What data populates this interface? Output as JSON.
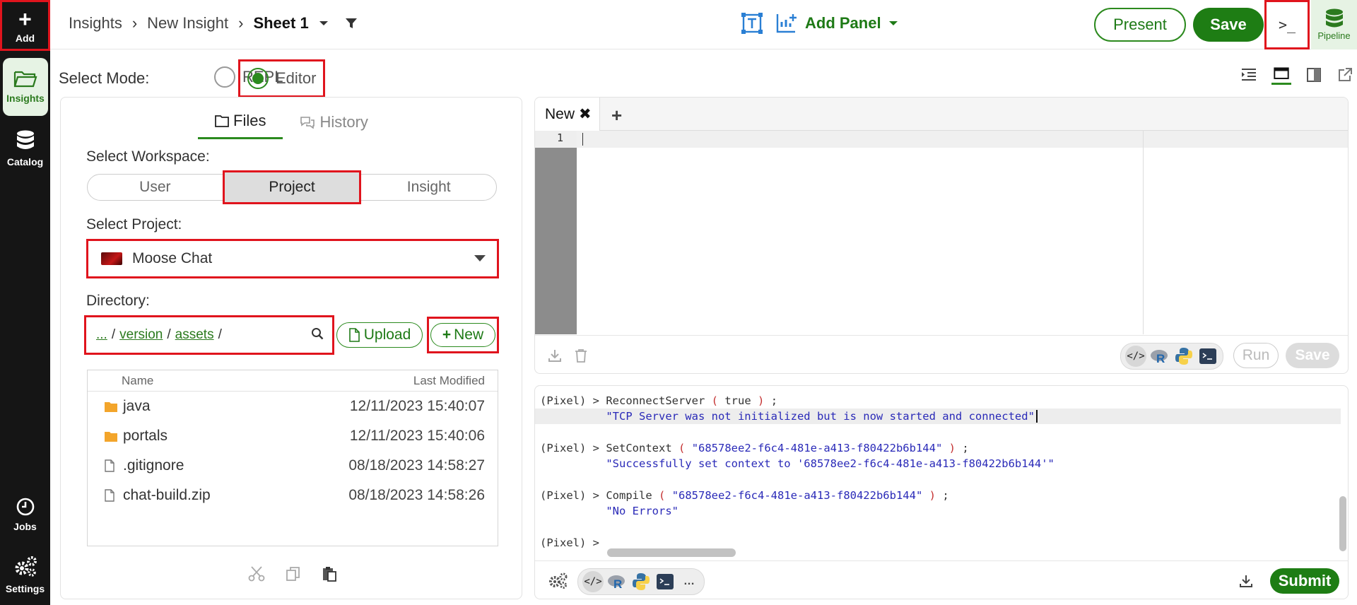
{
  "rail": {
    "add_label": "Add",
    "insights_label": "Insights",
    "catalog_label": "Catalog",
    "jobs_label": "Jobs",
    "settings_label": "Settings"
  },
  "header": {
    "crumbs": [
      "Insights",
      "New Insight"
    ],
    "sheet": "Sheet 1",
    "add_panel_label": "Add Panel",
    "present_label": "Present",
    "save_label": "Save",
    "terminal_glyph": ">_",
    "pipeline_label": "Pipeline"
  },
  "mode": {
    "label": "Select Mode:",
    "options": [
      "REPL",
      "Editor"
    ],
    "selected": "Editor"
  },
  "files_panel": {
    "tabs": [
      "Files",
      "History"
    ],
    "active_tab": "Files",
    "workspace_label": "Select Workspace:",
    "workspaces": [
      "User",
      "Project",
      "Insight"
    ],
    "selected_workspace": "Project",
    "project_label": "Select Project:",
    "project_value": "Moose Chat",
    "directory_label": "Directory:",
    "path_segments": [
      "...",
      "version",
      "assets"
    ],
    "upload_label": "Upload",
    "new_label": "New",
    "columns": [
      "Name",
      "Last Modified"
    ],
    "files": [
      {
        "name": "java",
        "type": "folder",
        "modified": "12/11/2023 15:40:07"
      },
      {
        "name": "portals",
        "type": "folder",
        "modified": "12/11/2023 15:40:06"
      },
      {
        "name": ".gitignore",
        "type": "file",
        "modified": "08/18/2023 14:58:27"
      },
      {
        "name": "chat-build.zip",
        "type": "file",
        "modified": "08/18/2023 14:58:26"
      }
    ]
  },
  "editor": {
    "tab_label": "New",
    "line_number": "1",
    "run_label": "Run",
    "save_label": "Save"
  },
  "console": {
    "prompt": "(Pixel) > ",
    "entries": [
      {
        "fn": "ReconnectServer",
        "arg": "true",
        "arg_is_string": false,
        "output": "\"TCP Server was not initialized but is now started and connected\""
      },
      {
        "fn": "SetContext",
        "arg": "\"68578ee2-f6c4-481e-a413-f80422b6b144\"",
        "arg_is_string": true,
        "output": "\"Successfully set context to '68578ee2-f6c4-481e-a413-f80422b6b144'\""
      },
      {
        "fn": "Compile",
        "arg": "\"68578ee2-f6c4-481e-a413-f80422b6b144\"",
        "arg_is_string": true,
        "output": "\"No Errors\""
      }
    ],
    "empty_prompt": "(Pixel) >",
    "submit_label": "Submit"
  },
  "colors": {
    "brand_green": "#1e7d14",
    "highlight_red": "#e0141d",
    "rail_bg": "#151515"
  }
}
